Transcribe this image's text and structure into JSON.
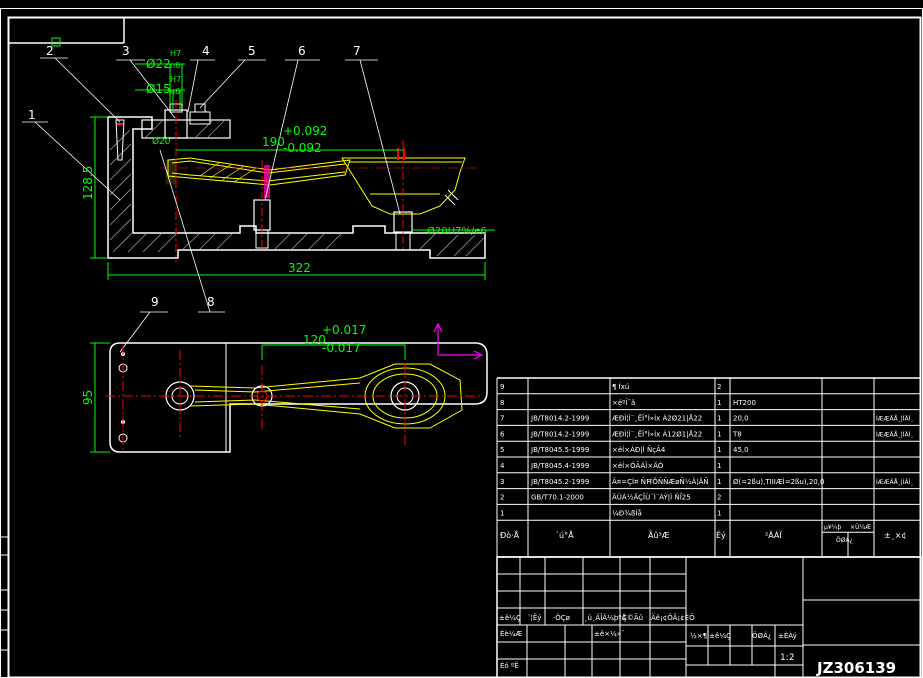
{
  "colors": {
    "background": "#000000",
    "frame": "#ffffff",
    "part": "#ffffff",
    "yellow_part": "#ffff00",
    "dimension": "#00ff00",
    "centerline": "#ff0000",
    "hatch": "#ffffff",
    "arrow": "#ff00ff"
  },
  "balloons": {
    "b1": "1",
    "b2": "2",
    "b3": "3",
    "b4": "4",
    "b5": "5",
    "b6": "6",
    "b7": "7",
    "b8": "8",
    "b9": "9"
  },
  "dims": {
    "d22": "Ø22",
    "fit_h7": "H7",
    "fit_n6": "n6",
    "d15": "Ø15",
    "fit_h7b": "H7",
    "fit_n6b": "n6",
    "h128": "128.5",
    "l190": "190",
    "tol190_up": "+0.092",
    "tol190_dn": "-0.092",
    "fit_small": "Ø20",
    "fit_right": "Ø20H7%/e6",
    "w322": "322",
    "l120": "120",
    "tol120_up": "+0.017",
    "tol120_dn": "-0.017",
    "h95": "95"
  },
  "bom": {
    "rows": [
      {
        "no": "9",
        "std": "",
        "name": "¶ Íxú",
        "qty": "2",
        "mat": "",
        "note": ""
      },
      {
        "no": "8",
        "std": "",
        "name": "×éºÏ¯ã",
        "qty": "1",
        "mat": "HT200",
        "note": ""
      },
      {
        "no": "7",
        "std": "JB/T8014.2-1999",
        "name": "ÆÐÌ¦Ì¨¸ÊÏ°Ì»Ìx Á2Ø21|Å22",
        "qty": "1",
        "mat": "20,0",
        "note": "ÍÆÆÄÅ¸|ÍÄÍ¸"
      },
      {
        "no": "6",
        "std": "JB/T8014.2-1999",
        "name": "ÆÐÌ¦Ì¨¸ÊÏ°Ì»Ìx Á12Ø1|Å22",
        "qty": "1",
        "mat": "T8",
        "note": "ÍÆÆÄÅ¸|ÍÄÍ¸"
      },
      {
        "no": "5",
        "std": "JB/T8045.5-1999",
        "name": "×éÍ×ÁÐ|Ì ÑçÂ4",
        "qty": "1",
        "mat": "45,0",
        "note": ""
      },
      {
        "no": "4",
        "std": "JB/T8045.4-1999",
        "name": "×éÍ×ÓÃÁÏ×ÄÓ",
        "qty": "1",
        "mat": "",
        "note": ""
      },
      {
        "no": "3",
        "std": "JB/T8045.2-1999",
        "name": "Ä¤=ÇÍ¤ ÑĦÔÑÑÆøÑ½Ä¦ÄÑ",
        "qty": "1",
        "mat": "Ø(=2ßu),TIIIÆÌ=2ßu),20,0",
        "note": "ÍÆÆÄÅ¸|ÍÄÍ¸"
      },
      {
        "no": "2",
        "std": "GB/T70.1-2000",
        "name": "ÄÙÁ½ÄÇÎÙ´Ì¨ÁÝ|Ì ÑÎ25",
        "qty": "2",
        "mat": "",
        "note": ""
      },
      {
        "no": "1",
        "std": "",
        "name": "¼Ð¾ßÌå",
        "qty": "1",
        "mat": "",
        "note": ""
      }
    ],
    "header": {
      "no": "Ðò·Å",
      "std": "´ú°Å",
      "name": "Ãû³Æ",
      "qty": "Êý",
      "mat": "²ÄÁÏ",
      "w1": "µ¥¼þ",
      "w2": "×Ü¼Æ",
      "w_sub": "ÖØÁ¿",
      "note": "±¸×¢"
    }
  },
  "title_block": {
    "row_labels": [
      "±ê¼Ç",
      "´¦Êý",
      "·ÖÇø",
      "¸ü¸ÄÎÄ¼þºÅ",
      "Ç©Ãû",
      "Äê¡¢ÔÂ¡¢ÈÕ"
    ],
    "design": "Éè¼Æ",
    "standard": "±ê×¼»¯",
    "check": "Éó ºË",
    "stage_mark": "½×¶Î±ê¼Ç",
    "weight": "ÖØÁ¿",
    "scale_lbl": "±ÈÀý",
    "scale": "1:2",
    "drawing_no": "JZ306139"
  }
}
